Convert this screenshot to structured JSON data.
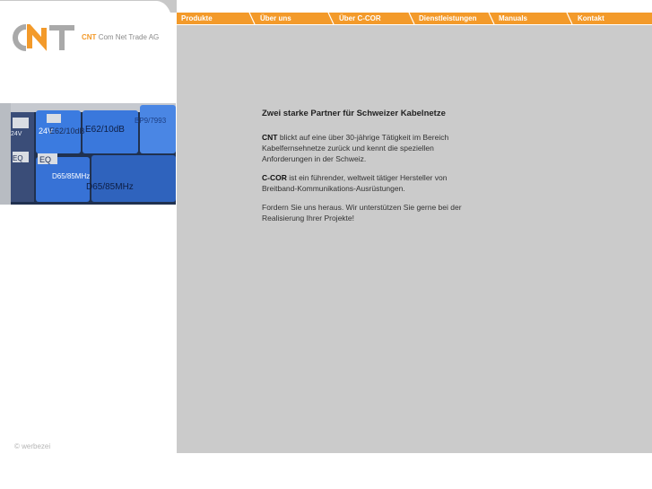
{
  "brand": {
    "logo_text": "CNT",
    "company_short": "CNT",
    "company_full": "Com Net Trade AG",
    "accent": "#f39a2a",
    "gray": "#cbcbcb"
  },
  "nav": {
    "items": [
      {
        "label": "Produkte"
      },
      {
        "label": "Über uns"
      },
      {
        "label": "Über C-COR"
      },
      {
        "label": "Dienstleistungen"
      },
      {
        "label": "Manuals"
      },
      {
        "label": "Kontakt"
      }
    ]
  },
  "photo": {
    "labels": [
      "24V",
      "BP9/7993",
      "24V",
      "E62/10dB",
      "E62/10dB",
      "EQ",
      "EQ",
      "D65/85MHz",
      "D65/85MHz"
    ]
  },
  "content": {
    "heading": "Zwei starke Partner für Schweizer Kabelnetze",
    "p1_strong": "CNT",
    "p1_text": " blickt auf eine über 30-jährige Tätigkeit im Bereich Kabelfernsehnetze zurück und kennt die speziellen Anforderungen in der Schweiz.",
    "p2_strong": "C-COR",
    "p2_text": " ist ein führender, weltweit tätiger Hersteller von Breitband-Kommunikations-Ausrüstungen.",
    "p3_text": "Fordern Sie uns heraus. Wir unterstützen Sie gerne bei der Realisierung Ihrer Projekte!"
  },
  "footer": {
    "copyright": "© werbezei"
  }
}
